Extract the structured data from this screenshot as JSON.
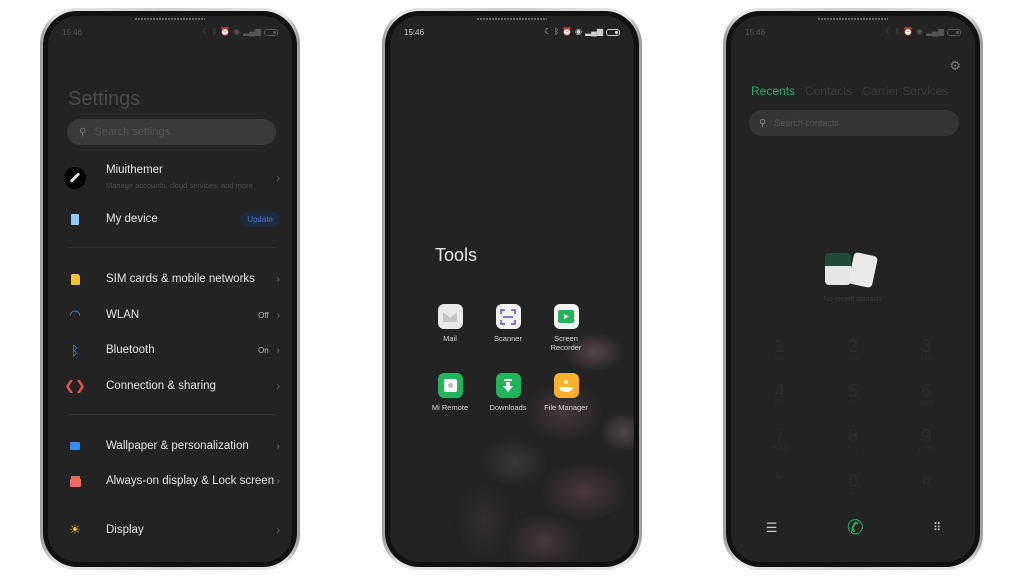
{
  "phones": {
    "settings": {
      "status": {
        "time": "15:46",
        "icons": [
          "moon-icon",
          "bluetooth-icon",
          "alarm-icon",
          "data-saver-icon",
          "signal-icon",
          "battery-icon"
        ]
      },
      "title": "Settings",
      "search": {
        "placeholder": "Search settings"
      },
      "account": {
        "name": "Miuithemer",
        "subtitle": "Manage accounts, cloud services, and more"
      },
      "my_device": {
        "label": "My device",
        "badge": "Update"
      },
      "items": [
        {
          "label": "SIM cards & mobile networks",
          "value": "",
          "icon": "sim-card-icon",
          "color": "#f2c230"
        },
        {
          "label": "WLAN",
          "value": "Off",
          "icon": "wifi-icon",
          "color": "#3ea0f0"
        },
        {
          "label": "Bluetooth",
          "value": "On",
          "icon": "bluetooth-icon",
          "color": "#3ea0f0"
        },
        {
          "label": "Connection & sharing",
          "value": "",
          "icon": "connection-sharing-icon",
          "color": "#e2564a"
        },
        {
          "label": "Wallpaper & personalization",
          "value": "",
          "icon": "wallpaper-icon",
          "color": "#2f8ff0"
        },
        {
          "label": "Always-on display & Lock screen",
          "value": "",
          "icon": "lock-icon",
          "color": "#ef6a5e"
        },
        {
          "label": "Display",
          "value": "",
          "icon": "sun-icon",
          "color": "#f4c12a"
        }
      ]
    },
    "tools": {
      "status": {
        "time": "15:46"
      },
      "folder_title": "Tools",
      "apps": [
        {
          "name": "Mail",
          "icon": "mail-icon",
          "bg": "#e9e9e9",
          "fg": "#bdbdbd"
        },
        {
          "name": "Scanner",
          "icon": "scanner-icon",
          "bg": "#f2f2f2",
          "fg": "#6a4ad0"
        },
        {
          "name": "Screen Recorder",
          "icon": "screen-recorder-icon",
          "bg": "#f2f2f2",
          "fg": "#22b45a"
        },
        {
          "name": "Mi Remote",
          "icon": "mi-remote-icon",
          "bg": "#22b45a",
          "fg": "#ffffff"
        },
        {
          "name": "Downloads",
          "icon": "downloads-icon",
          "bg": "#22b45a",
          "fg": "#ffffff"
        },
        {
          "name": "File Manager",
          "icon": "file-manager-icon",
          "bg": "#f7b12c",
          "fg": "#ffffff"
        }
      ]
    },
    "dialer": {
      "status": {
        "time": "15:46"
      },
      "tabs": [
        {
          "label": "Recents",
          "active": true
        },
        {
          "label": "Contacts",
          "active": false
        },
        {
          "label": "Carrier Services",
          "active": false
        }
      ],
      "search": {
        "placeholder": "Search contacts"
      },
      "empty_text": "No recent contacts",
      "keys": [
        {
          "digit": "1",
          "letters": "QO"
        },
        {
          "digit": "2",
          "letters": "ABC"
        },
        {
          "digit": "3",
          "letters": "DEF"
        },
        {
          "digit": "4",
          "letters": "GHI"
        },
        {
          "digit": "5",
          "letters": "JKL"
        },
        {
          "digit": "6",
          "letters": "MNO"
        },
        {
          "digit": "7",
          "letters": "PQRS"
        },
        {
          "digit": "8",
          "letters": "TUV"
        },
        {
          "digit": "9",
          "letters": "WXYZ"
        },
        {
          "digit": "*",
          "letters": ","
        },
        {
          "digit": "0",
          "letters": "+"
        },
        {
          "digit": "#",
          "letters": ""
        }
      ],
      "accent": "#2fa86a"
    }
  }
}
